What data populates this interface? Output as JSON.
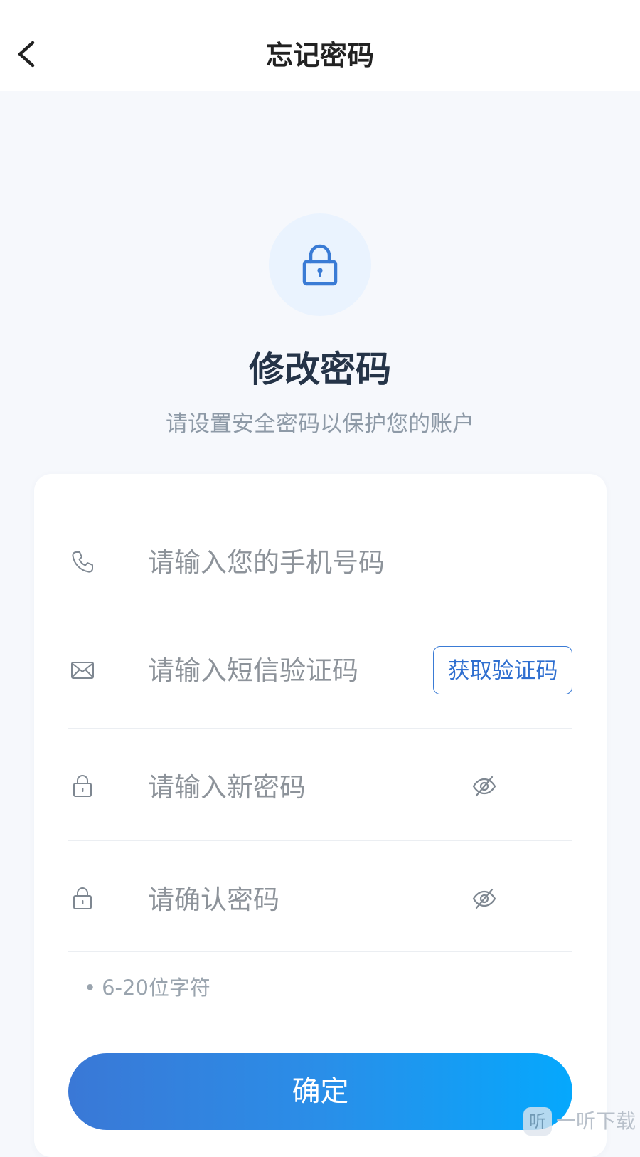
{
  "header": {
    "title": "忘记密码",
    "back_icon": "chevron-left-icon"
  },
  "hero": {
    "icon": "lock-icon",
    "title": "修改密码",
    "subtitle": "请设置安全密码以保护您的账户"
  },
  "form": {
    "phone": {
      "icon": "phone-icon",
      "placeholder": "请输入您的手机号码",
      "value": ""
    },
    "sms_code": {
      "icon": "envelope-icon",
      "placeholder": "请输入短信验证码",
      "value": "",
      "send_button_label": "获取验证码"
    },
    "new_password": {
      "icon": "lock-icon",
      "placeholder": "请输入新密码",
      "value": "",
      "toggle_icon": "eye-slash-icon"
    },
    "confirm_password": {
      "icon": "lock-icon",
      "placeholder": "请确认密码",
      "value": "",
      "toggle_icon": "eye-slash-icon"
    },
    "hint": "6-20位字符",
    "submit_label": "确定"
  },
  "watermark": {
    "logo_char": "听",
    "text": "一听下载"
  },
  "colors": {
    "accent": "#3a7bd5",
    "gradient_start": "#3a78d6",
    "gradient_end": "#05a8fd",
    "page_bg": "#f6f8fc",
    "title_text": "#253448"
  }
}
